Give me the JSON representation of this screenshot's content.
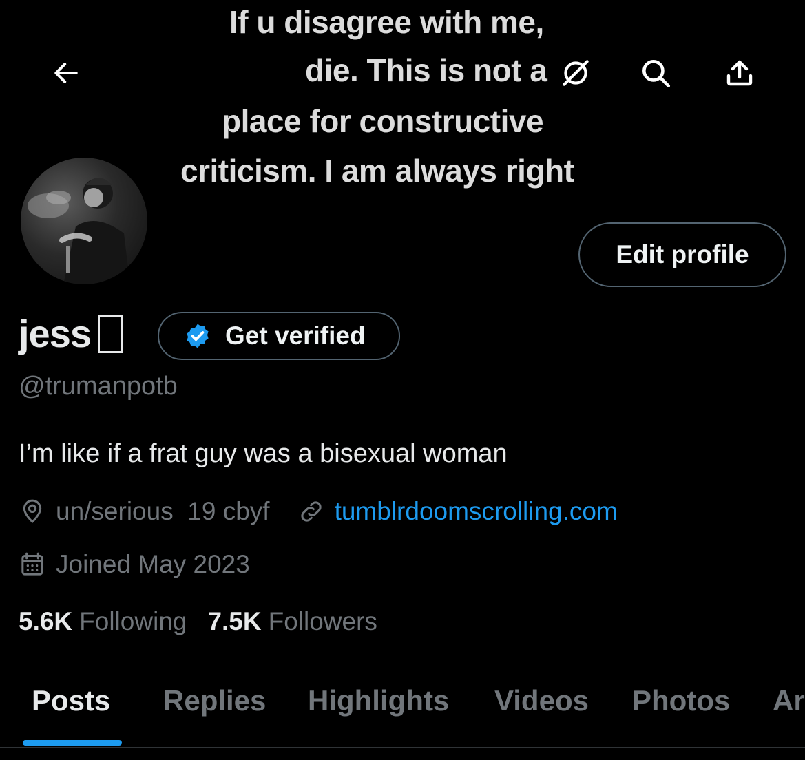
{
  "banner": {
    "lines": [
      "If u disagree with me,",
      "die.      This is not a",
      "place for constructive",
      "criticism. I am always right"
    ]
  },
  "topbar": {
    "back_icon": "arrow-left-icon",
    "hide_icon": "eye-slash-icon",
    "search_icon": "search-icon",
    "share_icon": "share-upload-icon"
  },
  "profile": {
    "edit_label": "Edit profile",
    "name": "jess",
    "verify_label": "Get verified",
    "handle": "@trumanpotb",
    "bio": "I’m like if a frat guy was a bisexual woman",
    "location": "un/serious  19 cbyf",
    "website": "tumblrdoomscrolling.com",
    "joined": "Joined May 2023",
    "following_count": "5.6K",
    "following_label": "Following",
    "followers_count": "7.5K",
    "followers_label": "Followers"
  },
  "tabs": [
    {
      "label": "Posts"
    },
    {
      "label": "Replies"
    },
    {
      "label": "Highlights"
    },
    {
      "label": "Videos"
    },
    {
      "label": "Photos"
    },
    {
      "label": "Ar"
    }
  ],
  "colors": {
    "accent": "#1d9bf0",
    "muted": "#71767b",
    "text": "#e7e9ea",
    "background": "#000000",
    "border": "#536471"
  }
}
